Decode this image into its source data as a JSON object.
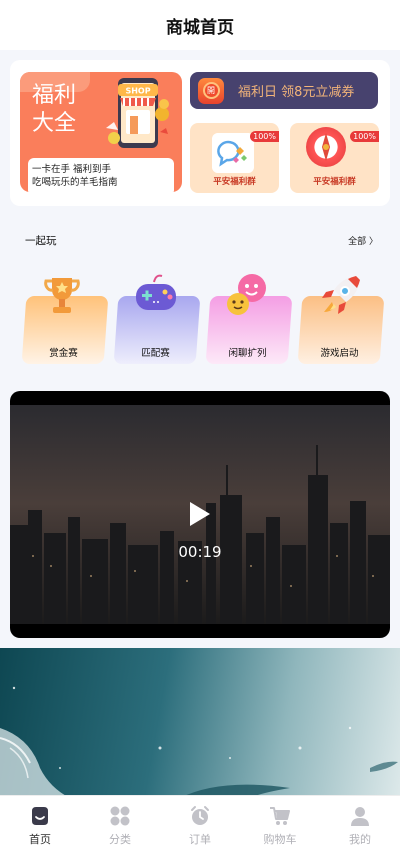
{
  "header": {
    "title": "商城首页"
  },
  "welfare": {
    "title_line1": "福利",
    "title_line2": "大全",
    "shop_sign": "SHOP",
    "desc_line1": "一卡在手 福利到手",
    "desc_line2": "吃喝玩乐的羊毛指南"
  },
  "coupon": {
    "icon_char": "開",
    "text": "福利日 领8元立减券"
  },
  "groups": [
    {
      "label": "平安福利群",
      "badge": "100%"
    },
    {
      "label": "平安福利群",
      "badge": "100%"
    }
  ],
  "section": {
    "title": "一起玩",
    "more": "全部 〉"
  },
  "games": [
    {
      "label": "赏金赛",
      "icon": "trophy-icon",
      "color_top": "#ffc27a",
      "color_bottom": "#fff3e6"
    },
    {
      "label": "匹配赛",
      "icon": "gamepad-icon",
      "color_top": "#a8a7ef",
      "color_bottom": "#eeeefc"
    },
    {
      "label": "闲聊扩列",
      "icon": "chat-faces-icon",
      "color_top": "#f49ee4",
      "color_bottom": "#fde9f8"
    },
    {
      "label": "游戏启动",
      "icon": "rocket-icon",
      "color_top": "#fbbf84",
      "color_bottom": "#fff0e2"
    }
  ],
  "video": {
    "time": "00:19"
  },
  "tabbar": {
    "items": [
      {
        "label": "首页",
        "icon": "home-icon",
        "active": true
      },
      {
        "label": "分类",
        "icon": "category-icon",
        "active": false
      },
      {
        "label": "订单",
        "icon": "order-clock-icon",
        "active": false
      },
      {
        "label": "购物车",
        "icon": "cart-icon",
        "active": false
      },
      {
        "label": "我的",
        "icon": "user-icon",
        "active": false
      }
    ]
  },
  "colors": {
    "accent_orange": "#fa7e5b",
    "coupon_bg": "#47426e",
    "coupon_text": "#f2b479",
    "group_bg": "#ffe3c6",
    "group_text": "#c83a25"
  }
}
